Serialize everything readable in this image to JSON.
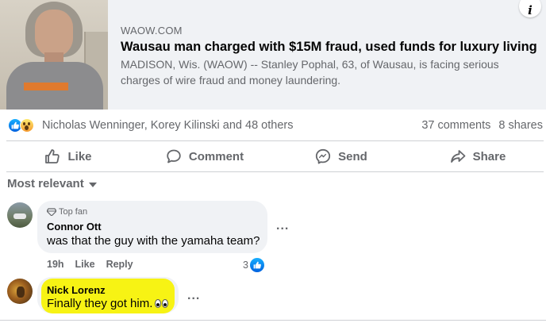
{
  "link_preview": {
    "domain": "WAOW.COM",
    "headline": "Wausau man charged with $15M fraud, used funds for luxury living",
    "summary": "MADISON, Wis. (WAOW) -- Stanley Pophal, 63, of Wausau, is facing serious charges of wire fraud and money laundering.",
    "info_icon": "i"
  },
  "reactions": {
    "icons": [
      "like-icon",
      "wow-icon"
    ],
    "reactors_text": "Nicholas Wenninger, Korey Kilinski and 48 others",
    "comments_count": "37 comments",
    "shares_count": "8 shares"
  },
  "actions": {
    "like": "Like",
    "comment": "Comment",
    "send": "Send",
    "share": "Share"
  },
  "sort": {
    "label": "Most relevant"
  },
  "comments": [
    {
      "badge": "Top fan",
      "author": "Connor Ott",
      "text": "was that the guy with the yamaha team?",
      "time": "19h",
      "like_label": "Like",
      "reply_label": "Reply",
      "reaction_count": "3",
      "more": "..."
    },
    {
      "author": "Nick Lorenz",
      "text": "Finally they got him.",
      "emoji": "eyes-emoji",
      "more": "...",
      "highlight_color": "#f7f300"
    }
  ],
  "colors": {
    "accent_blue": "#0866ff",
    "secondary_text": "#65676b",
    "bubble": "#f0f2f5"
  }
}
